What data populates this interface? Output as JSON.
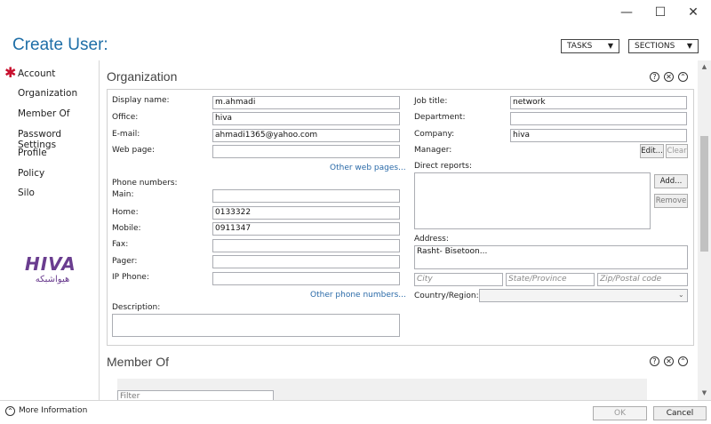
{
  "window": {
    "minimize": "—",
    "maximize": "☐",
    "close": "✕"
  },
  "header": {
    "title": "Create User:",
    "tasks": "TASKS",
    "sections": "SECTIONS"
  },
  "sidebar": {
    "items": [
      "Account",
      "Organization",
      "Member Of",
      "Password Settings",
      "Profile",
      "Policy",
      "Silo"
    ]
  },
  "logo": {
    "brand": "HIVA",
    "subtitle": "هیواشبکه"
  },
  "organization": {
    "title": "Organization",
    "display_name_label": "Display name:",
    "display_name": "m.ahmadi",
    "office_label": "Office:",
    "office": "hiva",
    "email_label": "E-mail:",
    "email": "ahmadi1365@yahoo.com",
    "web_page_label": "Web page:",
    "web_page": "",
    "other_web_pages": "Other web pages...",
    "phone_numbers_label": "Phone numbers:",
    "main_label": "Main:",
    "main": "",
    "home_label": "Home:",
    "home": "0133322",
    "mobile_label": "Mobile:",
    "mobile": "0911347",
    "fax_label": "Fax:",
    "fax": "",
    "pager_label": "Pager:",
    "pager": "",
    "ip_phone_label": "IP Phone:",
    "ip_phone": "",
    "other_phone_numbers": "Other phone numbers...",
    "description_label": "Description:",
    "description": "",
    "job_title_label": "Job title:",
    "job_title": "network",
    "department_label": "Department:",
    "department": "",
    "company_label": "Company:",
    "company": "hiva",
    "manager_label": "Manager:",
    "edit_button": "Edit...",
    "clear_button": "Clear",
    "direct_reports_label": "Direct reports:",
    "add_button": "Add...",
    "remove_button": "Remove",
    "address_label": "Address:",
    "address": "Rasht- Bisetoon...",
    "city_placeholder": "City",
    "state_placeholder": "State/Province",
    "zip_placeholder": "Zip/Postal code",
    "country_label": "Country/Region:",
    "country": ""
  },
  "member_of": {
    "title": "Member Of",
    "filter_placeholder": "Filter"
  },
  "footer": {
    "more_info": "More Information",
    "ok": "OK",
    "cancel": "Cancel"
  }
}
